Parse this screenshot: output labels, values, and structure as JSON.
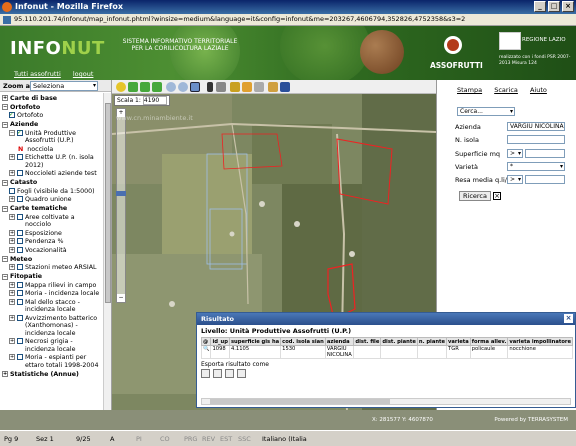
{
  "window": {
    "title": "Infonut - Mozilla Firefox",
    "url": "95.110.201.74/infonut/map_infonut.phtml?winsize=medium&language=it&config=infonut&me=203267,4606794,352826,4752358&s3=2"
  },
  "header": {
    "logo_pre": "INFO",
    "logo_post": "NUT",
    "subtitle": "SISTEMA INFORMATIVO TERRITORIALE PER LA CORILICOLTURA LAZIALE",
    "nav_links": [
      "Tutti assofrutti",
      "logout"
    ],
    "brand": "ASSOFRUTTI",
    "regione": "REGIONE LAZIO",
    "realizzato": "realizzato con i fondi PSR 2007-2013 Misura 124"
  },
  "zoom": {
    "label": "Zoom a",
    "value": "Seleziona"
  },
  "tree": {
    "carte_base": "Carte di base",
    "ortofoto": "Ortofoto",
    "ortofoto_item": "Ortofoto",
    "aziende": "Aziende",
    "unita": "Unità Produttive Assofrutti (U.P.)",
    "noccioli": "nocciola",
    "etichette": "Etichette U.P. (n. isola 2012)",
    "noccioleti": "Noccioleti aziende test",
    "catasto": "Catasto",
    "fogli": "Fogli (visibile da 1:5000)",
    "quadro": "Quadro unione",
    "carte_tem": "Carte tematiche",
    "aree": "Aree coltivate a nocciolo",
    "esposizione": "Esposizione",
    "pendenza": "Pendenza %",
    "vocazionalita": "Vocazionalità",
    "meteo": "Meteo",
    "stazioni": "Stazioni meteo ARSIAL",
    "fitopatie": "Fitopatie",
    "mappa": "Mappa rilievi in campo",
    "moria": "Moria - incidenza locale",
    "mal_stacco": "Mal dello stacco - incidenza locale",
    "avviz": "Avvizzimento batterico (Xanthomonas) - incidenza locale",
    "necrosi": "Necrosi grigia - incidenza locale",
    "moria_esp": "Moria - espianti per ettaro totali 1998-2004",
    "statistiche": "Statistiche (Annue)"
  },
  "map": {
    "scale_label": "Scala 1:",
    "scale_value": "4190",
    "watermark": "www.cn.minambiente.it"
  },
  "right_panel": {
    "links": [
      "Stampa",
      "Scarica",
      "Aiuto"
    ],
    "cerca": "Cerca...",
    "azienda_label": "Azienda",
    "azienda_value": "VARGIU NICOLINA",
    "isola_label": "N. isola",
    "sup_label": "Superficie mq",
    "sup_op": ">",
    "varieta_label": "Varietà",
    "varieta_value": "*",
    "resa_label": "Resa media q.li/ha",
    "resa_op": ">",
    "btn": "Ricerca"
  },
  "result": {
    "title": "Risultato",
    "level": "Livello: Unità Produttive Assofrutti (U.P.)",
    "headers": [
      "@",
      "id_up",
      "superficie gis ha",
      "cod. isola sian",
      "azienda",
      "dist. file",
      "dist. piante",
      "n. piante",
      "varieta",
      "forma allev.",
      "varieta impollinatore"
    ],
    "row": [
      "",
      "1098",
      "4.1105",
      "1530",
      "VARGIU NICOLINA",
      "",
      "",
      "",
      "TGR",
      "policaule",
      "nocchione"
    ],
    "export": "Esporta risultato come"
  },
  "footer": {
    "coords": "X: 281577  Y: 4607870",
    "powered": "Powered by TERRASYSTEM"
  },
  "statusbar": [
    "Pg  9",
    "Sez  1",
    "9/25",
    "A",
    "PI",
    "CO",
    "PRG",
    "REV",
    "EST",
    "SSC",
    "Italiano (Italia"
  ]
}
